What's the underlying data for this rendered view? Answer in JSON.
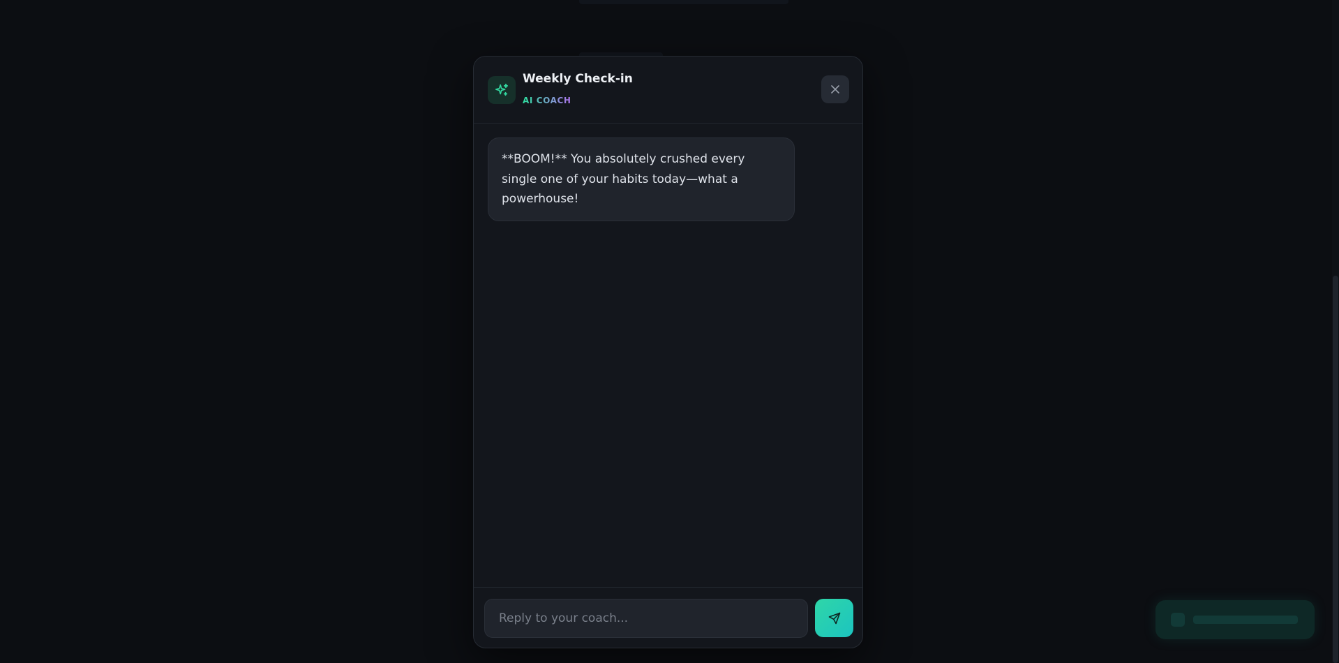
{
  "modal": {
    "title": "Weekly Check-in",
    "subtitle": "AI COACH",
    "coach_icon": "sparkles-icon",
    "close_icon": "close-icon"
  },
  "messages": [
    {
      "sender": "coach",
      "text": "**BOOM!** You absolutely crushed every single one of your habits today—what a powerhouse!"
    }
  ],
  "composer": {
    "placeholder": "Reply to your coach...",
    "value": "",
    "send_icon": "send-icon"
  },
  "colors": {
    "accent_start": "#2fd6a8",
    "accent_end": "#1cc4c0",
    "subtitle_gradient_end": "#b072f0",
    "modal_background": "#13161c",
    "page_background": "#0c0e12"
  }
}
